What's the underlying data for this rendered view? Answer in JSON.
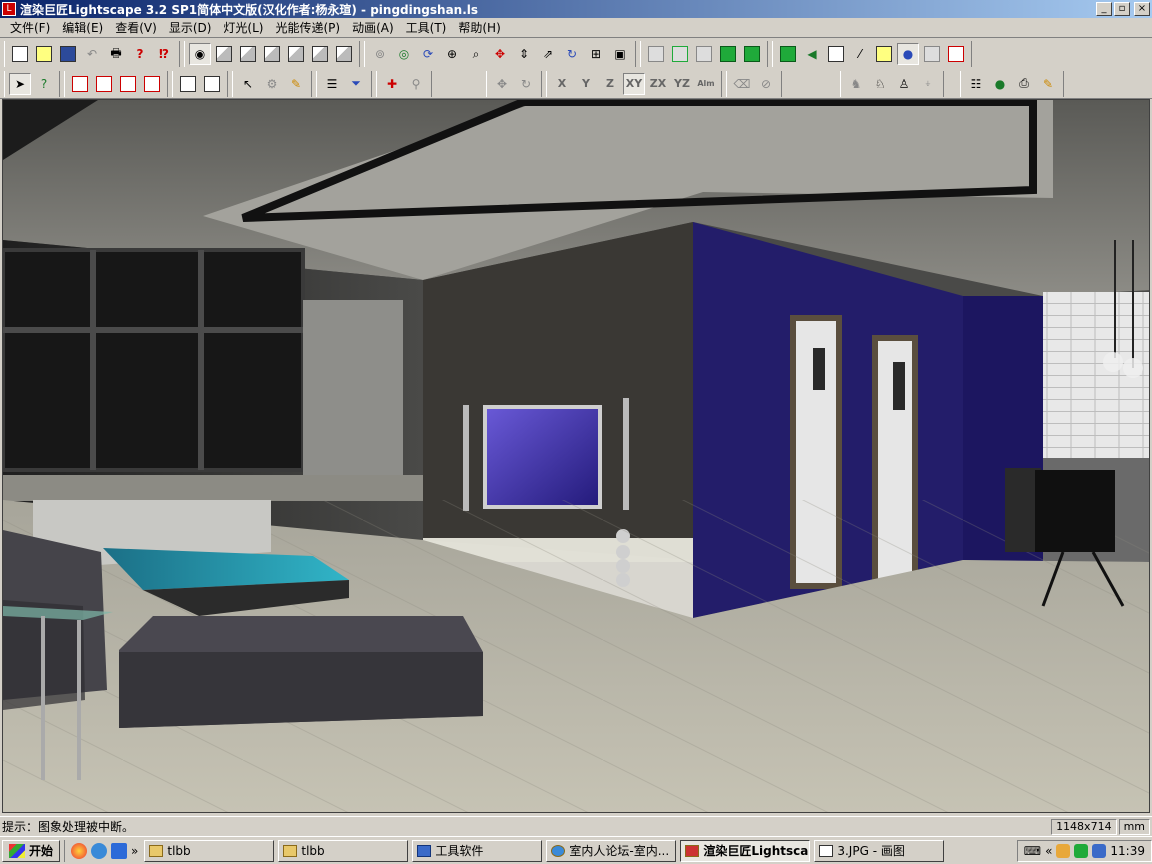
{
  "window": {
    "title": "渲染巨匠Lightscape 3.2 SP1简体中文版(汉化作者:杨永瑄) - pingdingshan.ls",
    "min_label": "_",
    "max_label": "▫",
    "close_label": "×"
  },
  "menu": {
    "items": [
      {
        "label": "文件(F)"
      },
      {
        "label": "编辑(E)"
      },
      {
        "label": "查看(V)"
      },
      {
        "label": "显示(D)"
      },
      {
        "label": "灯光(L)"
      },
      {
        "label": "光能传递(P)"
      },
      {
        "label": "动画(A)"
      },
      {
        "label": "工具(T)"
      },
      {
        "label": "帮助(H)"
      }
    ]
  },
  "toolbar2": {
    "axes": [
      "X",
      "Y",
      "Z",
      "XY",
      "ZX",
      "YZ",
      "Alm"
    ]
  },
  "status": {
    "message": "提示：图象处理被中断。",
    "resolution": "1148x714",
    "unit": "mm"
  },
  "taskbar": {
    "start_label": "开始",
    "tasks": [
      {
        "label": "tlbb"
      },
      {
        "label": "tlbb"
      },
      {
        "label": "工具软件"
      },
      {
        "label": "室内人论坛-室内..."
      },
      {
        "label": "渲染巨匠Lightscap..."
      },
      {
        "label": "3.JPG - 画图"
      }
    ],
    "clock": "11:39"
  },
  "colors": {
    "title_gradient_start": "#0a246a",
    "title_gradient_end": "#a6caf0",
    "chrome": "#d4d0c8"
  }
}
